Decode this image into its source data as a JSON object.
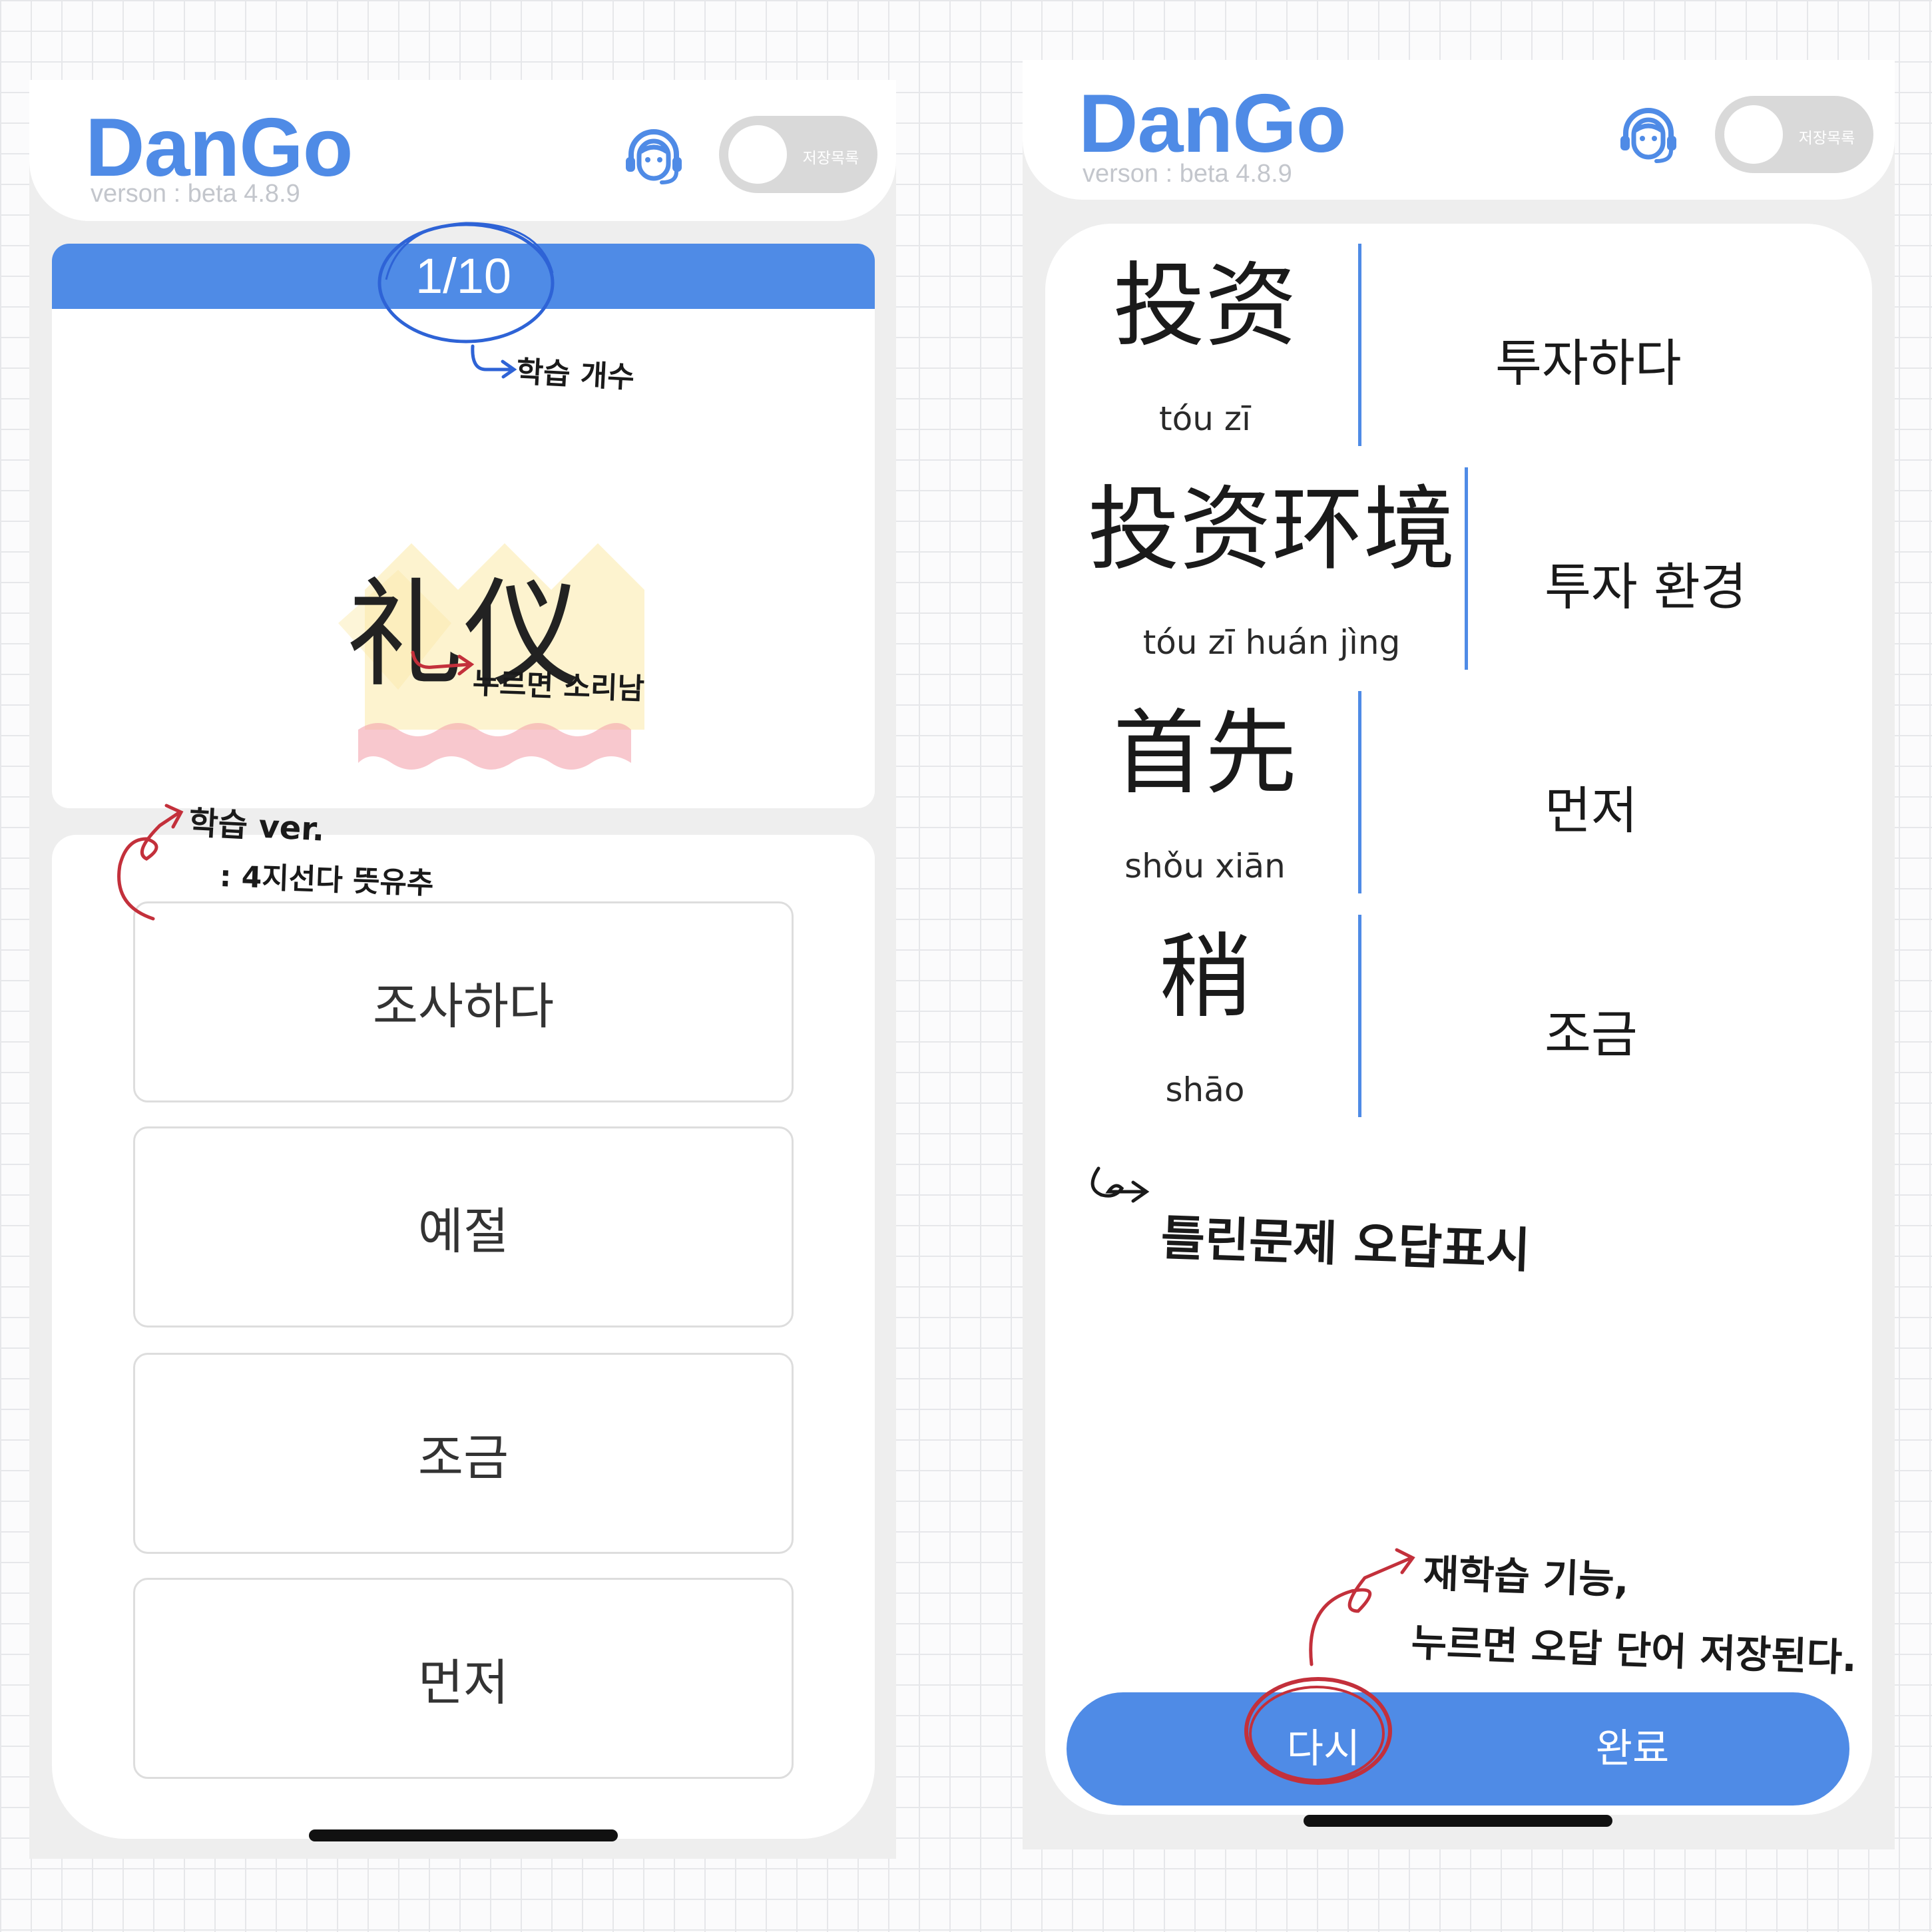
{
  "app": {
    "logo": "DanGo",
    "version": "verson : beta 4.8.9",
    "toggle_label": "저장목록",
    "brand_color": "#4f8be6"
  },
  "left_screen": {
    "progress": {
      "text": "1/10",
      "current": 1,
      "total": 10
    },
    "word": "礼仪",
    "options": [
      "조사하다",
      "예절",
      "조금",
      "먼저"
    ]
  },
  "right_screen": {
    "results": [
      {
        "hanzi": "投资",
        "pinyin": "tóu zī",
        "meaning": "투자하다"
      },
      {
        "hanzi": "投资环境",
        "pinyin": "tóu zī huán jìng",
        "meaning": "투자 환경"
      },
      {
        "hanzi": "首先",
        "pinyin": "shǒu xiān",
        "meaning": "먼저"
      },
      {
        "hanzi": "稍",
        "pinyin": "shāo",
        "meaning": "조금"
      }
    ],
    "actions": {
      "retry": "다시",
      "done": "완료"
    }
  },
  "annotations": {
    "count_note": "학습 개수",
    "sound_note": "누르면 소리남",
    "study_ver_line1": "학습 ver.",
    "study_ver_line2": ": 4지선다 뜻유추",
    "wrong_note": "틀린문제  오답표시",
    "relearn_line1": "재학습 기능,",
    "relearn_line2": "누르면 오답 단어 저장된다."
  }
}
